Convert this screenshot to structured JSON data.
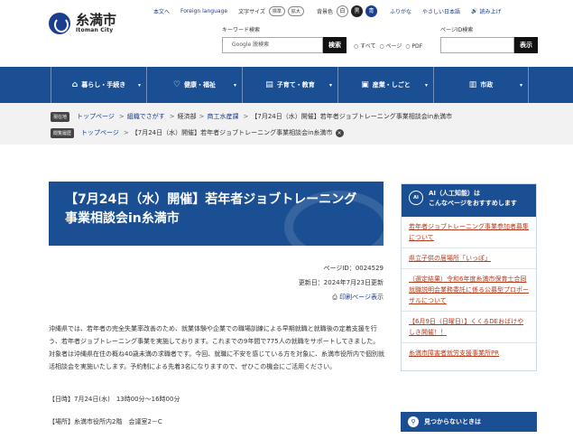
{
  "header": {
    "city_name": "糸満市",
    "city_name_en": "Itoman City",
    "util_links": [
      "本文へ",
      "Foreign language"
    ],
    "font_size_label": "文字サイズ",
    "font_size_options": [
      "標準",
      "拡大"
    ],
    "contrast_label": "背景色",
    "contrast_options": [
      "白",
      "黒",
      "青"
    ],
    "more_links": [
      "ふりがな",
      "やさしい日本語"
    ],
    "read_aloud": "読み上げ",
    "keyword_label": "キーワード検索",
    "keyword_placeholder": "Google 脱検索",
    "keyword_button": "検索",
    "scope_options": [
      "すべて",
      "ページ",
      "PDF"
    ],
    "page_id_label": "ページID検索",
    "page_id_button": "表示"
  },
  "nav": {
    "items": [
      {
        "label": "暮らし・手続き",
        "icon": "house-icon"
      },
      {
        "label": "健康・福祉",
        "icon": "heart-icon"
      },
      {
        "label": "子育て・教育",
        "icon": "book-icon"
      },
      {
        "label": "産業・しごと",
        "icon": "briefcase-icon"
      },
      {
        "label": "市政",
        "icon": "building-icon"
      }
    ]
  },
  "breadcrumbs": {
    "row1_tag": "現在地",
    "row1": [
      "トップページ",
      "組織でさがす",
      "経済部",
      "商工水産課",
      "【7月24日（水）開催】若年者ジョブトレーニング事業相談会in糸満市"
    ],
    "row2_tag": "閲覧履歴",
    "row2": [
      "トップページ",
      "【7月24日（水）開催】若年者ジョブトレーニング事業相談会in糸満市"
    ]
  },
  "article": {
    "title": "【7月24日（水）開催】若年者ジョブトレーニング事業相談会in糸満市",
    "page_id": "ページID：0024529",
    "updated": "更新日：2024年7月23日更新",
    "print_link": "印刷ページ表示",
    "body": "沖縄県では、若年者の完全失業率改善のため、就業体験や企業での職場訓練による早期就職と就職後の定着支援を行う、若年者ジョブトレーニング事業を実施しております。これまでの9年間で775人の就職をサポートしてきました。対象者は沖縄県在住の概ね40歳未満の求職者です。今回、就職に不安を感じている方を対象に、糸満市役所内で個別就活相談会を実施いたします。予約制による先着3名になりますので、ぜひこの機会にご活用ください。",
    "date_line": "【日時】7月24日(水)　13時00分～16時00分",
    "place_line": "【場所】糸満市役所内2階　会議室2－C"
  },
  "sidebar": {
    "ai_title": "AI（人工知能）は\nこんなページをおすすめします",
    "ai_badge": "AI",
    "links": [
      "若年者ジョブトレーニング事業参加者募集について",
      "県立子供の居場所「いっぽ」",
      "（選定結果）令和6年度糸満市保育士合同就職説明会業務委託に係る公募型プロポーザルについて",
      "【6月9日（日曜日）】くくるDEおばけやしき開催！！",
      "糸満市障害者就労支援事業所PR"
    ],
    "not_found_button": "見つからないときは"
  }
}
